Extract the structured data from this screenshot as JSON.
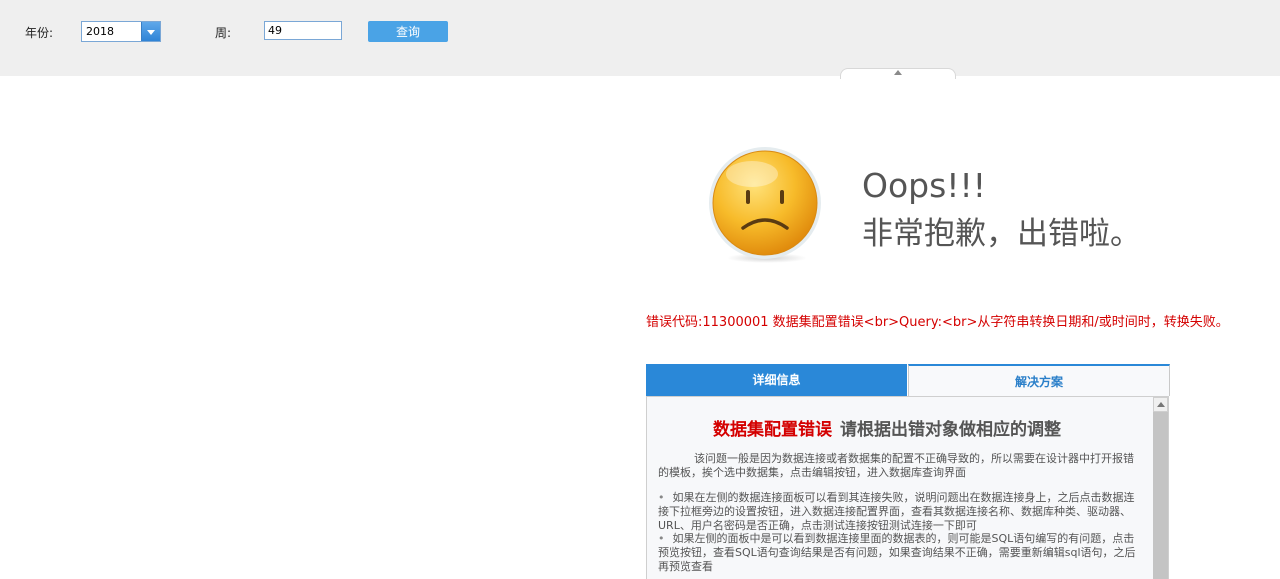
{
  "params": {
    "year_label": "年份:",
    "year_value": "2018",
    "week_label": "周:",
    "week_value": "49",
    "query_label": "查询"
  },
  "error_page": {
    "oops": "Oops!!!",
    "sorry": "非常抱歉，出错啦。",
    "message": "错误代码:11300001 数据集配置错误<br>Query:<br>从字符串转换日期和/或时间时，转换失败。",
    "tabs": {
      "detail": "详细信息",
      "solution": "解决方案"
    },
    "panel": {
      "title_red": "数据集配置错误",
      "title_gray": "请根据出错对象做相应的调整",
      "intro": "该问题一般是因为数据连接或者数据集的配置不正确导致的，所以需要在设计器中打开报错的模板，挨个选中数据集，点击编辑按钮，进入数据库查询界面",
      "bullet1": "如果在左侧的数据连接面板可以看到其连接失败，说明问题出在数据连接身上，之后点击数据连接下拉框旁边的设置按钮，进入数据连接配置界面，查看其数据连接名称、数据库种类、驱动器、URL、用户名密码是否正确，点击测试连接按钮测试连接一下即可",
      "bullet2": "如果左侧的面板中是可以看到数据连接里面的数据表的，则可能是SQL语句编写的有问题，点击预览按钮，查看SQL语句查询结果是否有问题，如果查询结果不正确，需要重新编辑sql语句，之后再预览查看"
    }
  },
  "colors": {
    "accent_blue": "#2a88d8",
    "error_red": "#d40000",
    "face_yellow": "#f5b21e"
  },
  "icons": {
    "combo_arrow": "chevron-down-icon",
    "collapse": "chevron-up-icon",
    "face": "sad-face-icon",
    "scroll_up": "scroll-up-icon"
  }
}
